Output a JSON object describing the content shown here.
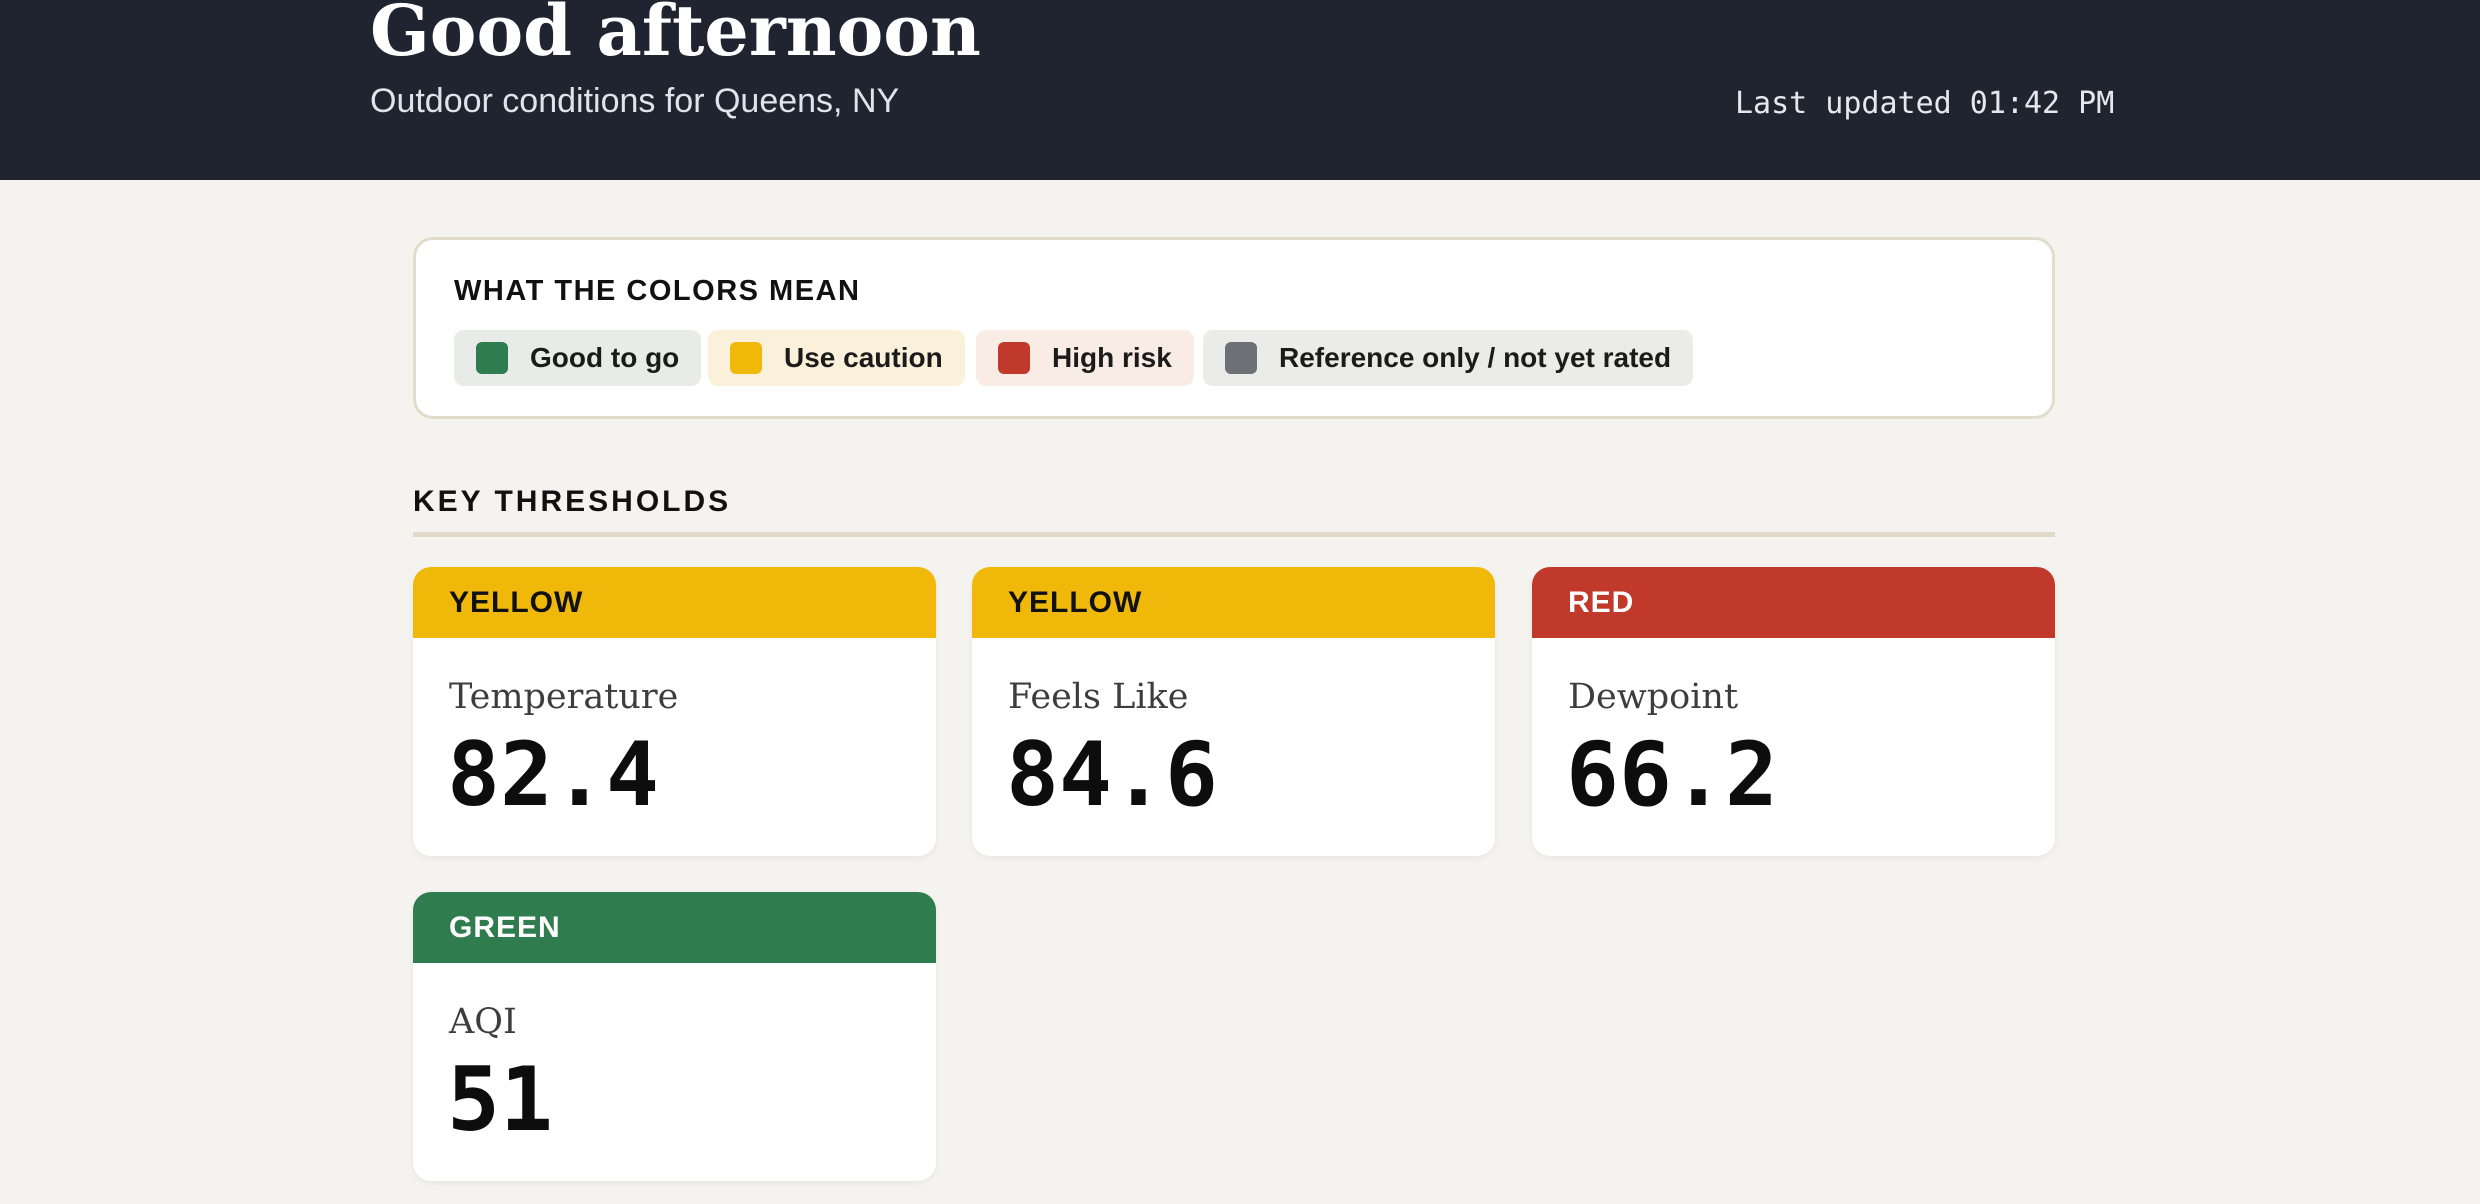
{
  "header": {
    "greeting": "Good afternoon",
    "subtitle": "Outdoor conditions for Queens, NY",
    "last_updated": "Last updated 01:42 PM",
    "background": "#1f2430"
  },
  "legend": {
    "title": "WHAT THE COLORS MEAN",
    "items": [
      {
        "label": "Good to go",
        "swatch": "#2f7d4f",
        "background": "#e8ebe8"
      },
      {
        "label": "Use caution",
        "swatch": "#f0b90a",
        "background": "#fbf1da"
      },
      {
        "label": "High risk",
        "swatch": "#c0392b",
        "background": "#f8ece4"
      },
      {
        "label": "Reference only / not yet rated",
        "swatch": "#6f7075",
        "background": "#ebebe9"
      }
    ]
  },
  "thresholds": {
    "title": "KEY THRESHOLDS",
    "tiles": [
      {
        "status": "YELLOW",
        "label": "Temperature",
        "value": "82.4",
        "band_color": "#f0b90a",
        "band_text_color": "#111111",
        "icon": "status-band"
      },
      {
        "status": "YELLOW",
        "label": "Feels Like",
        "value": "84.6",
        "band_color": "#f0b90a",
        "band_text_color": "#111111",
        "icon": "status-band"
      },
      {
        "status": "RED",
        "label": "Dewpoint",
        "value": "66.2",
        "band_color": "#c0392b",
        "band_text_color": "#ffffff",
        "icon": "status-band"
      },
      {
        "status": "GREEN",
        "label": "AQI",
        "value": "51",
        "band_color": "#2f7d4f",
        "band_text_color": "#ffffff",
        "icon": "status-band"
      }
    ]
  }
}
